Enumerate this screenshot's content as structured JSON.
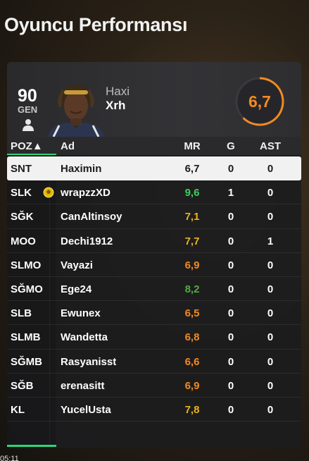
{
  "screen": {
    "title": "Oyuncu Performansı"
  },
  "player": {
    "overall": "90",
    "gen_label": "GEN",
    "first_name": "Haxi",
    "last_name": "Xrh",
    "match_rating": "6,7",
    "rating_color": "#f08a24"
  },
  "table": {
    "headers": {
      "pos": "POZ▲",
      "name": "Ad",
      "mr": "MR",
      "g": "G",
      "ast": "AST"
    },
    "rows": [
      {
        "pos": "SNT",
        "name": "Haximin",
        "mr": "6,7",
        "g": "0",
        "ast": "0",
        "rating_color": "#1b1b1b",
        "selected": true
      },
      {
        "pos": "SLK",
        "name": "wrapzzXD",
        "mr": "9,6",
        "g": "1",
        "ast": "0",
        "rating_color": "#3ccf5a",
        "motm": true
      },
      {
        "pos": "SĞK",
        "name": "CanAltinsoy",
        "mr": "7,1",
        "g": "0",
        "ast": "0",
        "rating_color": "#e9b321"
      },
      {
        "pos": "MOO",
        "name": "Dechi1912",
        "mr": "7,7",
        "g": "0",
        "ast": "1",
        "rating_color": "#e9b321"
      },
      {
        "pos": "SLMO",
        "name": "Vayazi",
        "mr": "6,9",
        "g": "0",
        "ast": "0",
        "rating_color": "#f08a24"
      },
      {
        "pos": "SĞMO",
        "name": "Ege24",
        "mr": "8,2",
        "g": "0",
        "ast": "0",
        "rating_color": "#4fae3d"
      },
      {
        "pos": "SLB",
        "name": "Ewunex",
        "mr": "6,5",
        "g": "0",
        "ast": "0",
        "rating_color": "#f08a24"
      },
      {
        "pos": "SLMB",
        "name": "Wandetta",
        "mr": "6,8",
        "g": "0",
        "ast": "0",
        "rating_color": "#f08a24"
      },
      {
        "pos": "SĞMB",
        "name": "Rasyanisst",
        "mr": "6,6",
        "g": "0",
        "ast": "0",
        "rating_color": "#f08a24"
      },
      {
        "pos": "SĞB",
        "name": "erenasitt",
        "mr": "6,9",
        "g": "0",
        "ast": "0",
        "rating_color": "#f08a24"
      },
      {
        "pos": "KL",
        "name": "YucelUsta",
        "mr": "7,8",
        "g": "0",
        "ast": "0",
        "rating_color": "#e9b321"
      }
    ]
  },
  "status": {
    "clock": "05:11"
  },
  "colors": {
    "accent": "#2fd47a",
    "panel": "#1c1c1e"
  },
  "icons": {
    "person": "person-icon",
    "motm": "motm-ball-icon"
  }
}
